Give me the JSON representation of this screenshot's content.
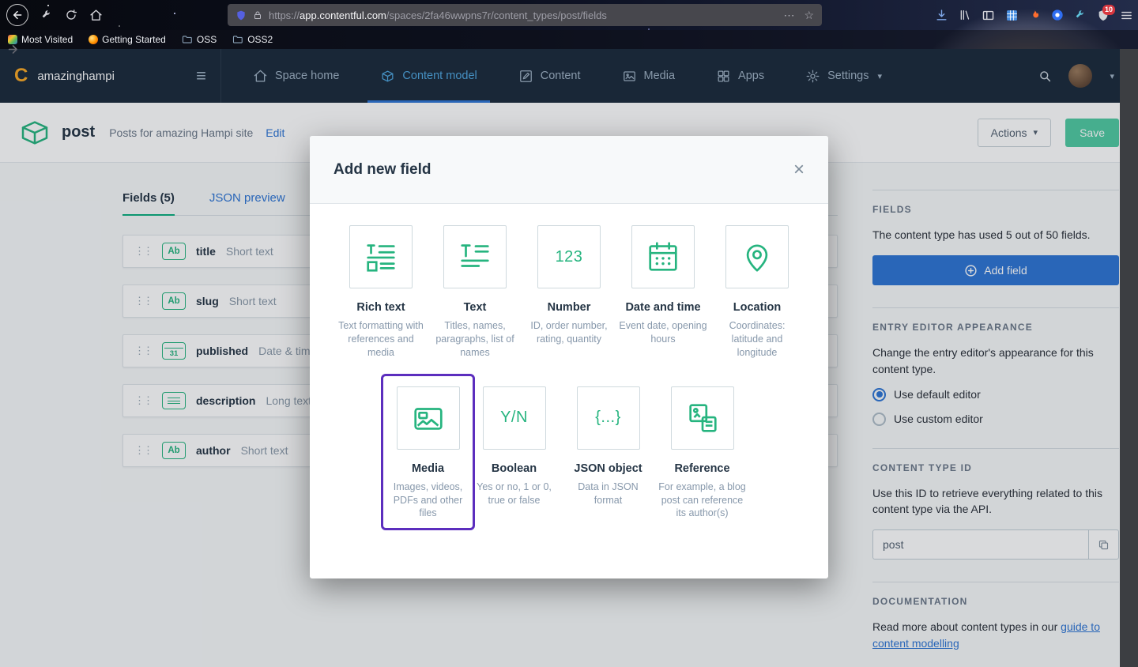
{
  "browser": {
    "url": {
      "scheme": "https://",
      "host": "app.contentful.com",
      "path": "/spaces/2fa46wwpns7r/content_types/post/fields"
    },
    "bookmarks": [
      "Most Visited",
      "Getting Started",
      "OSS",
      "OSS2"
    ],
    "extension_badge": "10"
  },
  "nav": {
    "space_name": "amazinghampi",
    "items": [
      {
        "label": "Space home"
      },
      {
        "label": "Content model"
      },
      {
        "label": "Content"
      },
      {
        "label": "Media"
      },
      {
        "label": "Apps"
      },
      {
        "label": "Settings"
      }
    ]
  },
  "header": {
    "title": "post",
    "subtitle": "Posts for amazing Hampi site",
    "edit": "Edit",
    "actions": "Actions",
    "save": "Save"
  },
  "tabs": {
    "fields": "Fields (5)",
    "json": "JSON preview"
  },
  "fields": [
    {
      "name": "title",
      "type": "Short text",
      "icon_text": "Ab"
    },
    {
      "name": "slug",
      "type": "Short text",
      "icon_text": "Ab"
    },
    {
      "name": "published",
      "type": "Date & time",
      "icon_text": "31"
    },
    {
      "name": "description",
      "type": "Long text"
    },
    {
      "name": "author",
      "type": "Short text",
      "icon_text": "Ab"
    }
  ],
  "modal": {
    "title": "Add new field",
    "types": [
      {
        "name": "Rich text",
        "desc": "Text formatting with references and media"
      },
      {
        "name": "Text",
        "desc": "Titles, names, paragraphs, list of names"
      },
      {
        "name": "Number",
        "desc": "ID, order number, rating, quantity",
        "icon_text": "123"
      },
      {
        "name": "Date and time",
        "desc": "Event date, opening hours"
      },
      {
        "name": "Location",
        "desc": "Coordinates: latitude and longitude"
      },
      {
        "name": "Media",
        "desc": "Images, videos, PDFs and other files"
      },
      {
        "name": "Boolean",
        "desc": "Yes or no, 1 or 0, true or false",
        "icon_text": "Y/N"
      },
      {
        "name": "JSON object",
        "desc": "Data in JSON format",
        "icon_text": "{...}"
      },
      {
        "name": "Reference",
        "desc": "For example, a blog post can reference its author(s)"
      }
    ]
  },
  "sidebar": {
    "fields_heading": "FIELDS",
    "usage": "The content type has used 5 out of 50 fields.",
    "add_field": "Add field",
    "appearance_heading": "ENTRY EDITOR APPEARANCE",
    "appearance_text": "Change the entry editor's appearance for this content type.",
    "radio_default": "Use default editor",
    "radio_custom": "Use custom editor",
    "id_heading": "CONTENT TYPE ID",
    "id_text": "Use this ID to retrieve everything related to this content type via the API.",
    "id_value": "post",
    "doc_heading": "DOCUMENTATION",
    "doc_text": "Read more about content types in our ",
    "doc_link": "guide to content modelling"
  },
  "icons": {
    "caret": "▾",
    "close": "×",
    "dots_h": "⋯",
    "star": "☆",
    "drag": "⋮⋮",
    "burger": "≡"
  },
  "colors": {
    "green": "#26b47f",
    "blue": "#2e75d4",
    "purple": "#5c2ebe",
    "nav_bg": "#1b2a3b",
    "nav_active": "#4fa7e0"
  }
}
